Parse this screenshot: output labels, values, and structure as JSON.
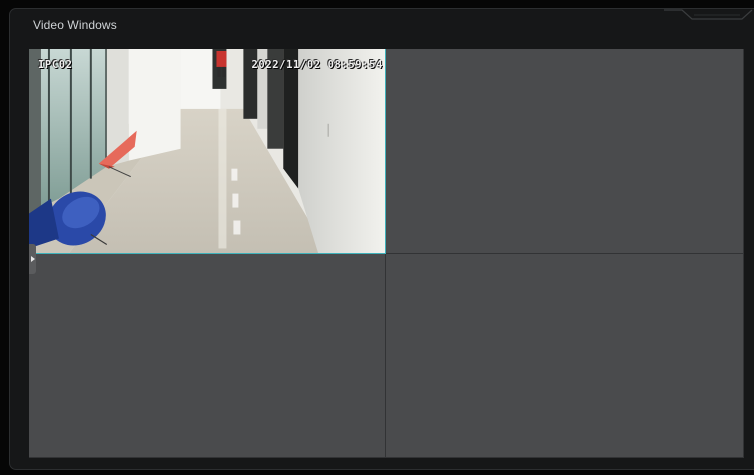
{
  "panel": {
    "title": "Video Windows"
  },
  "windows": [
    {
      "camera_name": "IPC02",
      "timestamp": "2022/11/02 08:59:54",
      "state": "playing"
    },
    {
      "state": "empty"
    },
    {
      "state": "empty"
    },
    {
      "state": "empty"
    }
  ],
  "colors": {
    "active_border": "#3fb2bb",
    "empty_cell": "#4a4b4d",
    "panel_bg": "#161718"
  },
  "icons": {
    "side_handle": "chevron-right-icon"
  }
}
